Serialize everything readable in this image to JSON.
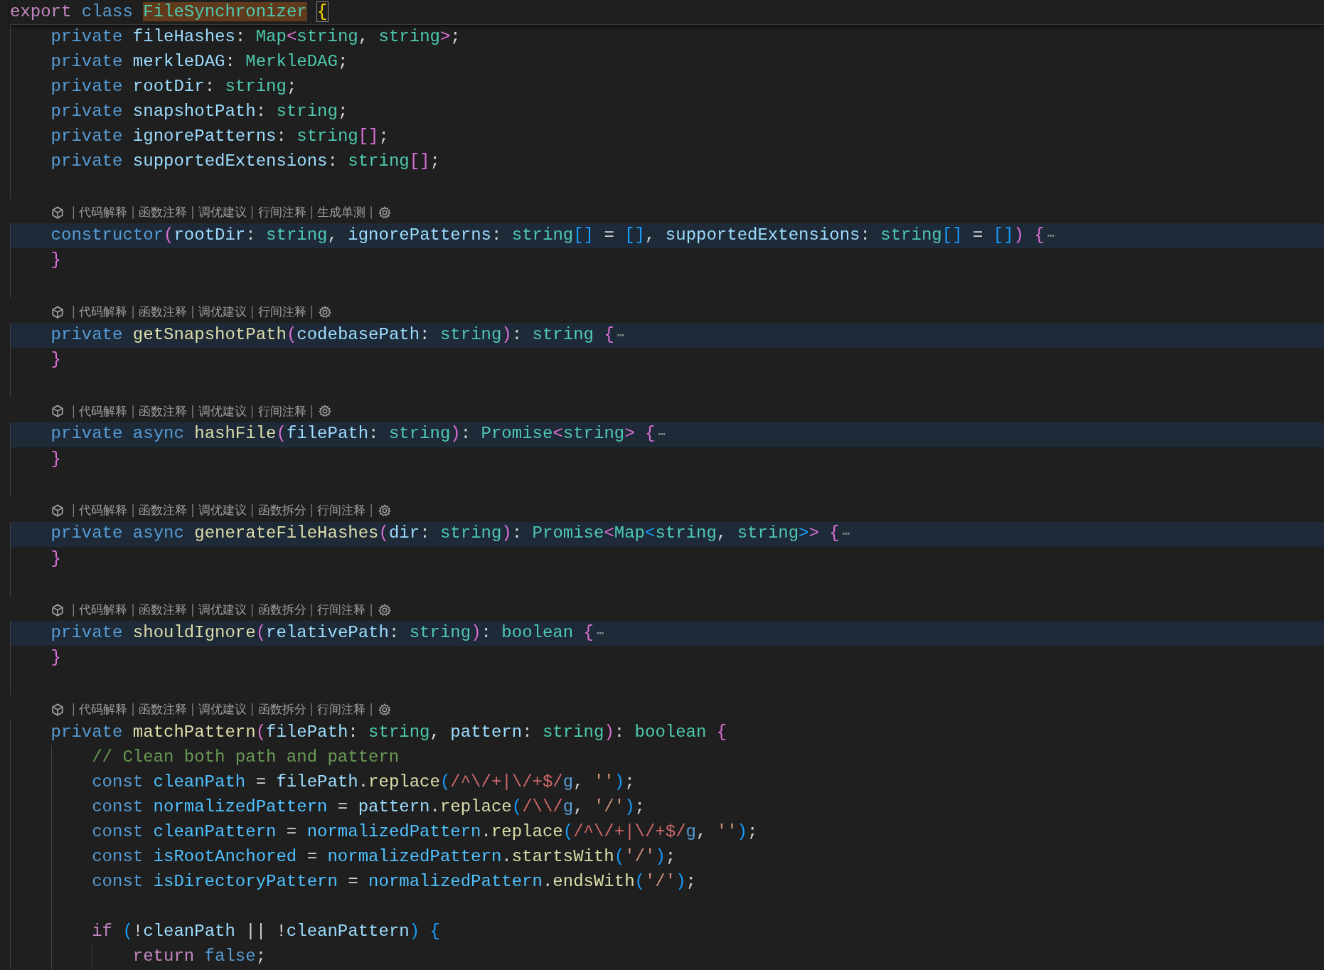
{
  "editor": {
    "lines": [
      {
        "kind": "code",
        "sticky": true,
        "tokens": [
          {
            "kind": "ctl",
            "text": "export"
          },
          {
            "kind": "kw",
            "text": " class"
          },
          {
            "kind": "type",
            "text": " FileSynchronizer",
            "search_match": true
          },
          {
            "kind": "br1",
            "text": " {",
            "bracket_match": true
          }
        ],
        "children": [
          {
            "kind": "code",
            "tokens": [
              {
                "kind": "kw",
                "text": "private"
              },
              {
                "kind": "var",
                "text": " fileHashes"
              },
              {
                "kind": "pl",
                "text": ": "
              },
              {
                "kind": "type",
                "text": "Map"
              },
              {
                "kind": "br2",
                "text": "<"
              },
              {
                "kind": "type",
                "text": "string"
              },
              {
                "kind": "pl",
                "text": ", "
              },
              {
                "kind": "type",
                "text": "string"
              },
              {
                "kind": "br2",
                "text": ">"
              },
              {
                "kind": "pl",
                "text": ";"
              }
            ]
          },
          {
            "kind": "code",
            "tokens": [
              {
                "kind": "kw",
                "text": "private"
              },
              {
                "kind": "var",
                "text": " merkleDAG"
              },
              {
                "kind": "pl",
                "text": ": "
              },
              {
                "kind": "type",
                "text": "MerkleDAG"
              },
              {
                "kind": "pl",
                "text": ";"
              }
            ]
          },
          {
            "kind": "code",
            "tokens": [
              {
                "kind": "kw",
                "text": "private"
              },
              {
                "kind": "var",
                "text": " rootDir"
              },
              {
                "kind": "pl",
                "text": ": "
              },
              {
                "kind": "type",
                "text": "string"
              },
              {
                "kind": "pl",
                "text": ";"
              }
            ]
          },
          {
            "kind": "code",
            "tokens": [
              {
                "kind": "kw",
                "text": "private"
              },
              {
                "kind": "var",
                "text": " snapshotPath"
              },
              {
                "kind": "pl",
                "text": ": "
              },
              {
                "kind": "type",
                "text": "string"
              },
              {
                "kind": "pl",
                "text": ";"
              }
            ]
          },
          {
            "kind": "code",
            "tokens": [
              {
                "kind": "kw",
                "text": "private"
              },
              {
                "kind": "var",
                "text": " ignorePatterns"
              },
              {
                "kind": "pl",
                "text": ": "
              },
              {
                "kind": "type",
                "text": "string"
              },
              {
                "kind": "br2",
                "text": "[]"
              },
              {
                "kind": "pl",
                "text": ";"
              }
            ]
          },
          {
            "kind": "code",
            "tokens": [
              {
                "kind": "kw",
                "text": "private"
              },
              {
                "kind": "var",
                "text": " supportedExtensions"
              },
              {
                "kind": "pl",
                "text": ": "
              },
              {
                "kind": "type",
                "text": "string"
              },
              {
                "kind": "br2",
                "text": "[]"
              },
              {
                "kind": "pl",
                "text": ";"
              }
            ]
          },
          {
            "kind": "blank"
          },
          {
            "kind": "lens",
            "separator": "|",
            "items": [
              "代码解释",
              "函数注释",
              "调优建议",
              "行间注释",
              "生成单测"
            ]
          },
          {
            "kind": "code",
            "highlighted": true,
            "tokens": [
              {
                "kind": "kw",
                "text": "constructor"
              },
              {
                "kind": "br2",
                "text": "("
              },
              {
                "kind": "var",
                "text": "rootDir"
              },
              {
                "kind": "pl",
                "text": ": "
              },
              {
                "kind": "type",
                "text": "string"
              },
              {
                "kind": "pl",
                "text": ", "
              },
              {
                "kind": "var",
                "text": "ignorePatterns"
              },
              {
                "kind": "pl",
                "text": ": "
              },
              {
                "kind": "type",
                "text": "string"
              },
              {
                "kind": "br3",
                "text": "[]"
              },
              {
                "kind": "pl",
                "text": " = "
              },
              {
                "kind": "br3",
                "text": "[]"
              },
              {
                "kind": "pl",
                "text": ", "
              },
              {
                "kind": "var",
                "text": "supportedExtensions"
              },
              {
                "kind": "pl",
                "text": ": "
              },
              {
                "kind": "type",
                "text": "string"
              },
              {
                "kind": "br3",
                "text": "[]"
              },
              {
                "kind": "pl",
                "text": " = "
              },
              {
                "kind": "br3",
                "text": "[]"
              },
              {
                "kind": "br2",
                "text": ")"
              },
              {
                "kind": "br2",
                "text": " {"
              },
              {
                "kind": "fold",
                "text": "⋯"
              }
            ]
          },
          {
            "kind": "code",
            "tokens": [
              {
                "kind": "br2",
                "text": "}"
              }
            ]
          },
          {
            "kind": "blank"
          },
          {
            "kind": "lens",
            "separator": "|",
            "items": [
              "代码解释",
              "函数注释",
              "调优建议",
              "行间注释"
            ]
          },
          {
            "kind": "code",
            "highlighted": true,
            "tokens": [
              {
                "kind": "kw",
                "text": "private"
              },
              {
                "kind": "fn",
                "text": " getSnapshotPath"
              },
              {
                "kind": "br2",
                "text": "("
              },
              {
                "kind": "var",
                "text": "codebasePath"
              },
              {
                "kind": "pl",
                "text": ": "
              },
              {
                "kind": "type",
                "text": "string"
              },
              {
                "kind": "br2",
                "text": ")"
              },
              {
                "kind": "pl",
                "text": ": "
              },
              {
                "kind": "type",
                "text": "string"
              },
              {
                "kind": "br2",
                "text": " {"
              },
              {
                "kind": "fold",
                "text": "⋯"
              }
            ]
          },
          {
            "kind": "code",
            "tokens": [
              {
                "kind": "br2",
                "text": "}"
              }
            ]
          },
          {
            "kind": "blank"
          },
          {
            "kind": "lens",
            "separator": "|",
            "items": [
              "代码解释",
              "函数注释",
              "调优建议",
              "行间注释"
            ]
          },
          {
            "kind": "code",
            "highlighted": true,
            "tokens": [
              {
                "kind": "kw",
                "text": "private"
              },
              {
                "kind": "kw",
                "text": " async"
              },
              {
                "kind": "fn",
                "text": " hashFile"
              },
              {
                "kind": "br2",
                "text": "("
              },
              {
                "kind": "var",
                "text": "filePath"
              },
              {
                "kind": "pl",
                "text": ": "
              },
              {
                "kind": "type",
                "text": "string"
              },
              {
                "kind": "br2",
                "text": ")"
              },
              {
                "kind": "pl",
                "text": ": "
              },
              {
                "kind": "type",
                "text": "Promise"
              },
              {
                "kind": "br2",
                "text": "<"
              },
              {
                "kind": "type",
                "text": "string"
              },
              {
                "kind": "br2",
                "text": ">"
              },
              {
                "kind": "br2",
                "text": " {"
              },
              {
                "kind": "fold",
                "text": "⋯"
              }
            ]
          },
          {
            "kind": "code",
            "tokens": [
              {
                "kind": "br2",
                "text": "}"
              }
            ]
          },
          {
            "kind": "blank"
          },
          {
            "kind": "lens",
            "separator": "|",
            "items": [
              "代码解释",
              "函数注释",
              "调优建议",
              "函数拆分",
              "行间注释"
            ]
          },
          {
            "kind": "code",
            "highlighted": true,
            "tokens": [
              {
                "kind": "kw",
                "text": "private"
              },
              {
                "kind": "kw",
                "text": " async"
              },
              {
                "kind": "fn",
                "text": " generateFileHashes"
              },
              {
                "kind": "br2",
                "text": "("
              },
              {
                "kind": "var",
                "text": "dir"
              },
              {
                "kind": "pl",
                "text": ": "
              },
              {
                "kind": "type",
                "text": "string"
              },
              {
                "kind": "br2",
                "text": ")"
              },
              {
                "kind": "pl",
                "text": ": "
              },
              {
                "kind": "type",
                "text": "Promise"
              },
              {
                "kind": "br2",
                "text": "<"
              },
              {
                "kind": "type",
                "text": "Map"
              },
              {
                "kind": "br3",
                "text": "<"
              },
              {
                "kind": "type",
                "text": "string"
              },
              {
                "kind": "pl",
                "text": ", "
              },
              {
                "kind": "type",
                "text": "string"
              },
              {
                "kind": "br3",
                "text": ">"
              },
              {
                "kind": "br2",
                "text": ">"
              },
              {
                "kind": "br2",
                "text": " {"
              },
              {
                "kind": "fold",
                "text": "⋯"
              }
            ]
          },
          {
            "kind": "code",
            "tokens": [
              {
                "kind": "br2",
                "text": "}"
              }
            ]
          },
          {
            "kind": "blank"
          },
          {
            "kind": "lens",
            "separator": "|",
            "items": [
              "代码解释",
              "函数注释",
              "调优建议",
              "函数拆分",
              "行间注释"
            ]
          },
          {
            "kind": "code",
            "highlighted": true,
            "tokens": [
              {
                "kind": "kw",
                "text": "private"
              },
              {
                "kind": "fn",
                "text": " shouldIgnore"
              },
              {
                "kind": "br2",
                "text": "("
              },
              {
                "kind": "var",
                "text": "relativePath"
              },
              {
                "kind": "pl",
                "text": ": "
              },
              {
                "kind": "type",
                "text": "string"
              },
              {
                "kind": "br2",
                "text": ")"
              },
              {
                "kind": "pl",
                "text": ": "
              },
              {
                "kind": "type",
                "text": "boolean"
              },
              {
                "kind": "br2",
                "text": " {"
              },
              {
                "kind": "fold",
                "text": "⋯"
              }
            ]
          },
          {
            "kind": "code",
            "tokens": [
              {
                "kind": "br2",
                "text": "}"
              }
            ]
          },
          {
            "kind": "blank"
          },
          {
            "kind": "lens",
            "separator": "|",
            "items": [
              "代码解释",
              "函数注释",
              "调优建议",
              "函数拆分",
              "行间注释"
            ]
          },
          {
            "kind": "code",
            "tokens": [
              {
                "kind": "kw",
                "text": "private"
              },
              {
                "kind": "fn",
                "text": " matchPattern"
              },
              {
                "kind": "br2",
                "text": "("
              },
              {
                "kind": "var",
                "text": "filePath"
              },
              {
                "kind": "pl",
                "text": ": "
              },
              {
                "kind": "type",
                "text": "string"
              },
              {
                "kind": "pl",
                "text": ", "
              },
              {
                "kind": "var",
                "text": "pattern"
              },
              {
                "kind": "pl",
                "text": ": "
              },
              {
                "kind": "type",
                "text": "string"
              },
              {
                "kind": "br2",
                "text": ")"
              },
              {
                "kind": "pl",
                "text": ": "
              },
              {
                "kind": "type",
                "text": "boolean"
              },
              {
                "kind": "br2",
                "text": " {"
              }
            ],
            "children": [
              {
                "kind": "code",
                "tokens": [
                  {
                    "kind": "cmt",
                    "text": "// Clean both path and pattern"
                  }
                ]
              },
              {
                "kind": "code",
                "tokens": [
                  {
                    "kind": "kw",
                    "text": "const"
                  },
                  {
                    "kind": "const",
                    "text": " cleanPath"
                  },
                  {
                    "kind": "pl",
                    "text": " = "
                  },
                  {
                    "kind": "var",
                    "text": "filePath"
                  },
                  {
                    "kind": "pl",
                    "text": "."
                  },
                  {
                    "kind": "fn",
                    "text": "replace"
                  },
                  {
                    "kind": "br3",
                    "text": "("
                  },
                  {
                    "kind": "re",
                    "text": "/^\\/+|\\/+$/"
                  },
                  {
                    "kind": "kw",
                    "text": "g"
                  },
                  {
                    "kind": "pl",
                    "text": ", "
                  },
                  {
                    "kind": "str",
                    "text": "''"
                  },
                  {
                    "kind": "br3",
                    "text": ")"
                  },
                  {
                    "kind": "pl",
                    "text": ";"
                  }
                ]
              },
              {
                "kind": "code",
                "tokens": [
                  {
                    "kind": "kw",
                    "text": "const"
                  },
                  {
                    "kind": "const",
                    "text": " normalizedPattern"
                  },
                  {
                    "kind": "pl",
                    "text": " = "
                  },
                  {
                    "kind": "var",
                    "text": "pattern"
                  },
                  {
                    "kind": "pl",
                    "text": "."
                  },
                  {
                    "kind": "fn",
                    "text": "replace"
                  },
                  {
                    "kind": "br3",
                    "text": "("
                  },
                  {
                    "kind": "re",
                    "text": "/\\\\/"
                  },
                  {
                    "kind": "kw",
                    "text": "g"
                  },
                  {
                    "kind": "pl",
                    "text": ", "
                  },
                  {
                    "kind": "str",
                    "text": "'/'"
                  },
                  {
                    "kind": "br3",
                    "text": ")"
                  },
                  {
                    "kind": "pl",
                    "text": ";"
                  }
                ]
              },
              {
                "kind": "code",
                "tokens": [
                  {
                    "kind": "kw",
                    "text": "const"
                  },
                  {
                    "kind": "const",
                    "text": " cleanPattern"
                  },
                  {
                    "kind": "pl",
                    "text": " = "
                  },
                  {
                    "kind": "const",
                    "text": "normalizedPattern"
                  },
                  {
                    "kind": "pl",
                    "text": "."
                  },
                  {
                    "kind": "fn",
                    "text": "replace"
                  },
                  {
                    "kind": "br3",
                    "text": "("
                  },
                  {
                    "kind": "re",
                    "text": "/^\\/+|\\/+$/"
                  },
                  {
                    "kind": "kw",
                    "text": "g"
                  },
                  {
                    "kind": "pl",
                    "text": ", "
                  },
                  {
                    "kind": "str",
                    "text": "''"
                  },
                  {
                    "kind": "br3",
                    "text": ")"
                  },
                  {
                    "kind": "pl",
                    "text": ";"
                  }
                ]
              },
              {
                "kind": "code",
                "tokens": [
                  {
                    "kind": "kw",
                    "text": "const"
                  },
                  {
                    "kind": "const",
                    "text": " isRootAnchored"
                  },
                  {
                    "kind": "pl",
                    "text": " = "
                  },
                  {
                    "kind": "const",
                    "text": "normalizedPattern"
                  },
                  {
                    "kind": "pl",
                    "text": "."
                  },
                  {
                    "kind": "fn",
                    "text": "startsWith"
                  },
                  {
                    "kind": "br3",
                    "text": "("
                  },
                  {
                    "kind": "str",
                    "text": "'/'"
                  },
                  {
                    "kind": "br3",
                    "text": ")"
                  },
                  {
                    "kind": "pl",
                    "text": ";"
                  }
                ]
              },
              {
                "kind": "code",
                "tokens": [
                  {
                    "kind": "kw",
                    "text": "const"
                  },
                  {
                    "kind": "const",
                    "text": " isDirectoryPattern"
                  },
                  {
                    "kind": "pl",
                    "text": " = "
                  },
                  {
                    "kind": "const",
                    "text": "normalizedPattern"
                  },
                  {
                    "kind": "pl",
                    "text": "."
                  },
                  {
                    "kind": "fn",
                    "text": "endsWith"
                  },
                  {
                    "kind": "br3",
                    "text": "("
                  },
                  {
                    "kind": "str",
                    "text": "'/'"
                  },
                  {
                    "kind": "br3",
                    "text": ")"
                  },
                  {
                    "kind": "pl",
                    "text": ";"
                  }
                ]
              },
              {
                "kind": "blank"
              },
              {
                "kind": "code",
                "tokens": [
                  {
                    "kind": "ctl",
                    "text": "if"
                  },
                  {
                    "kind": "br3",
                    "text": " ("
                  },
                  {
                    "kind": "pl",
                    "text": "!"
                  },
                  {
                    "kind": "var",
                    "text": "cleanPath"
                  },
                  {
                    "kind": "pl",
                    "text": " || !"
                  },
                  {
                    "kind": "var",
                    "text": "cleanPattern"
                  },
                  {
                    "kind": "br3",
                    "text": ")"
                  },
                  {
                    "kind": "br3",
                    "text": " {"
                  }
                ],
                "children": [
                  {
                    "kind": "code",
                    "tokens": [
                      {
                        "kind": "ctl",
                        "text": "return"
                      },
                      {
                        "kind": "kw",
                        "text": " false"
                      },
                      {
                        "kind": "pl",
                        "text": ";"
                      }
                    ]
                  }
                ]
              }
            ]
          }
        ]
      }
    ]
  }
}
